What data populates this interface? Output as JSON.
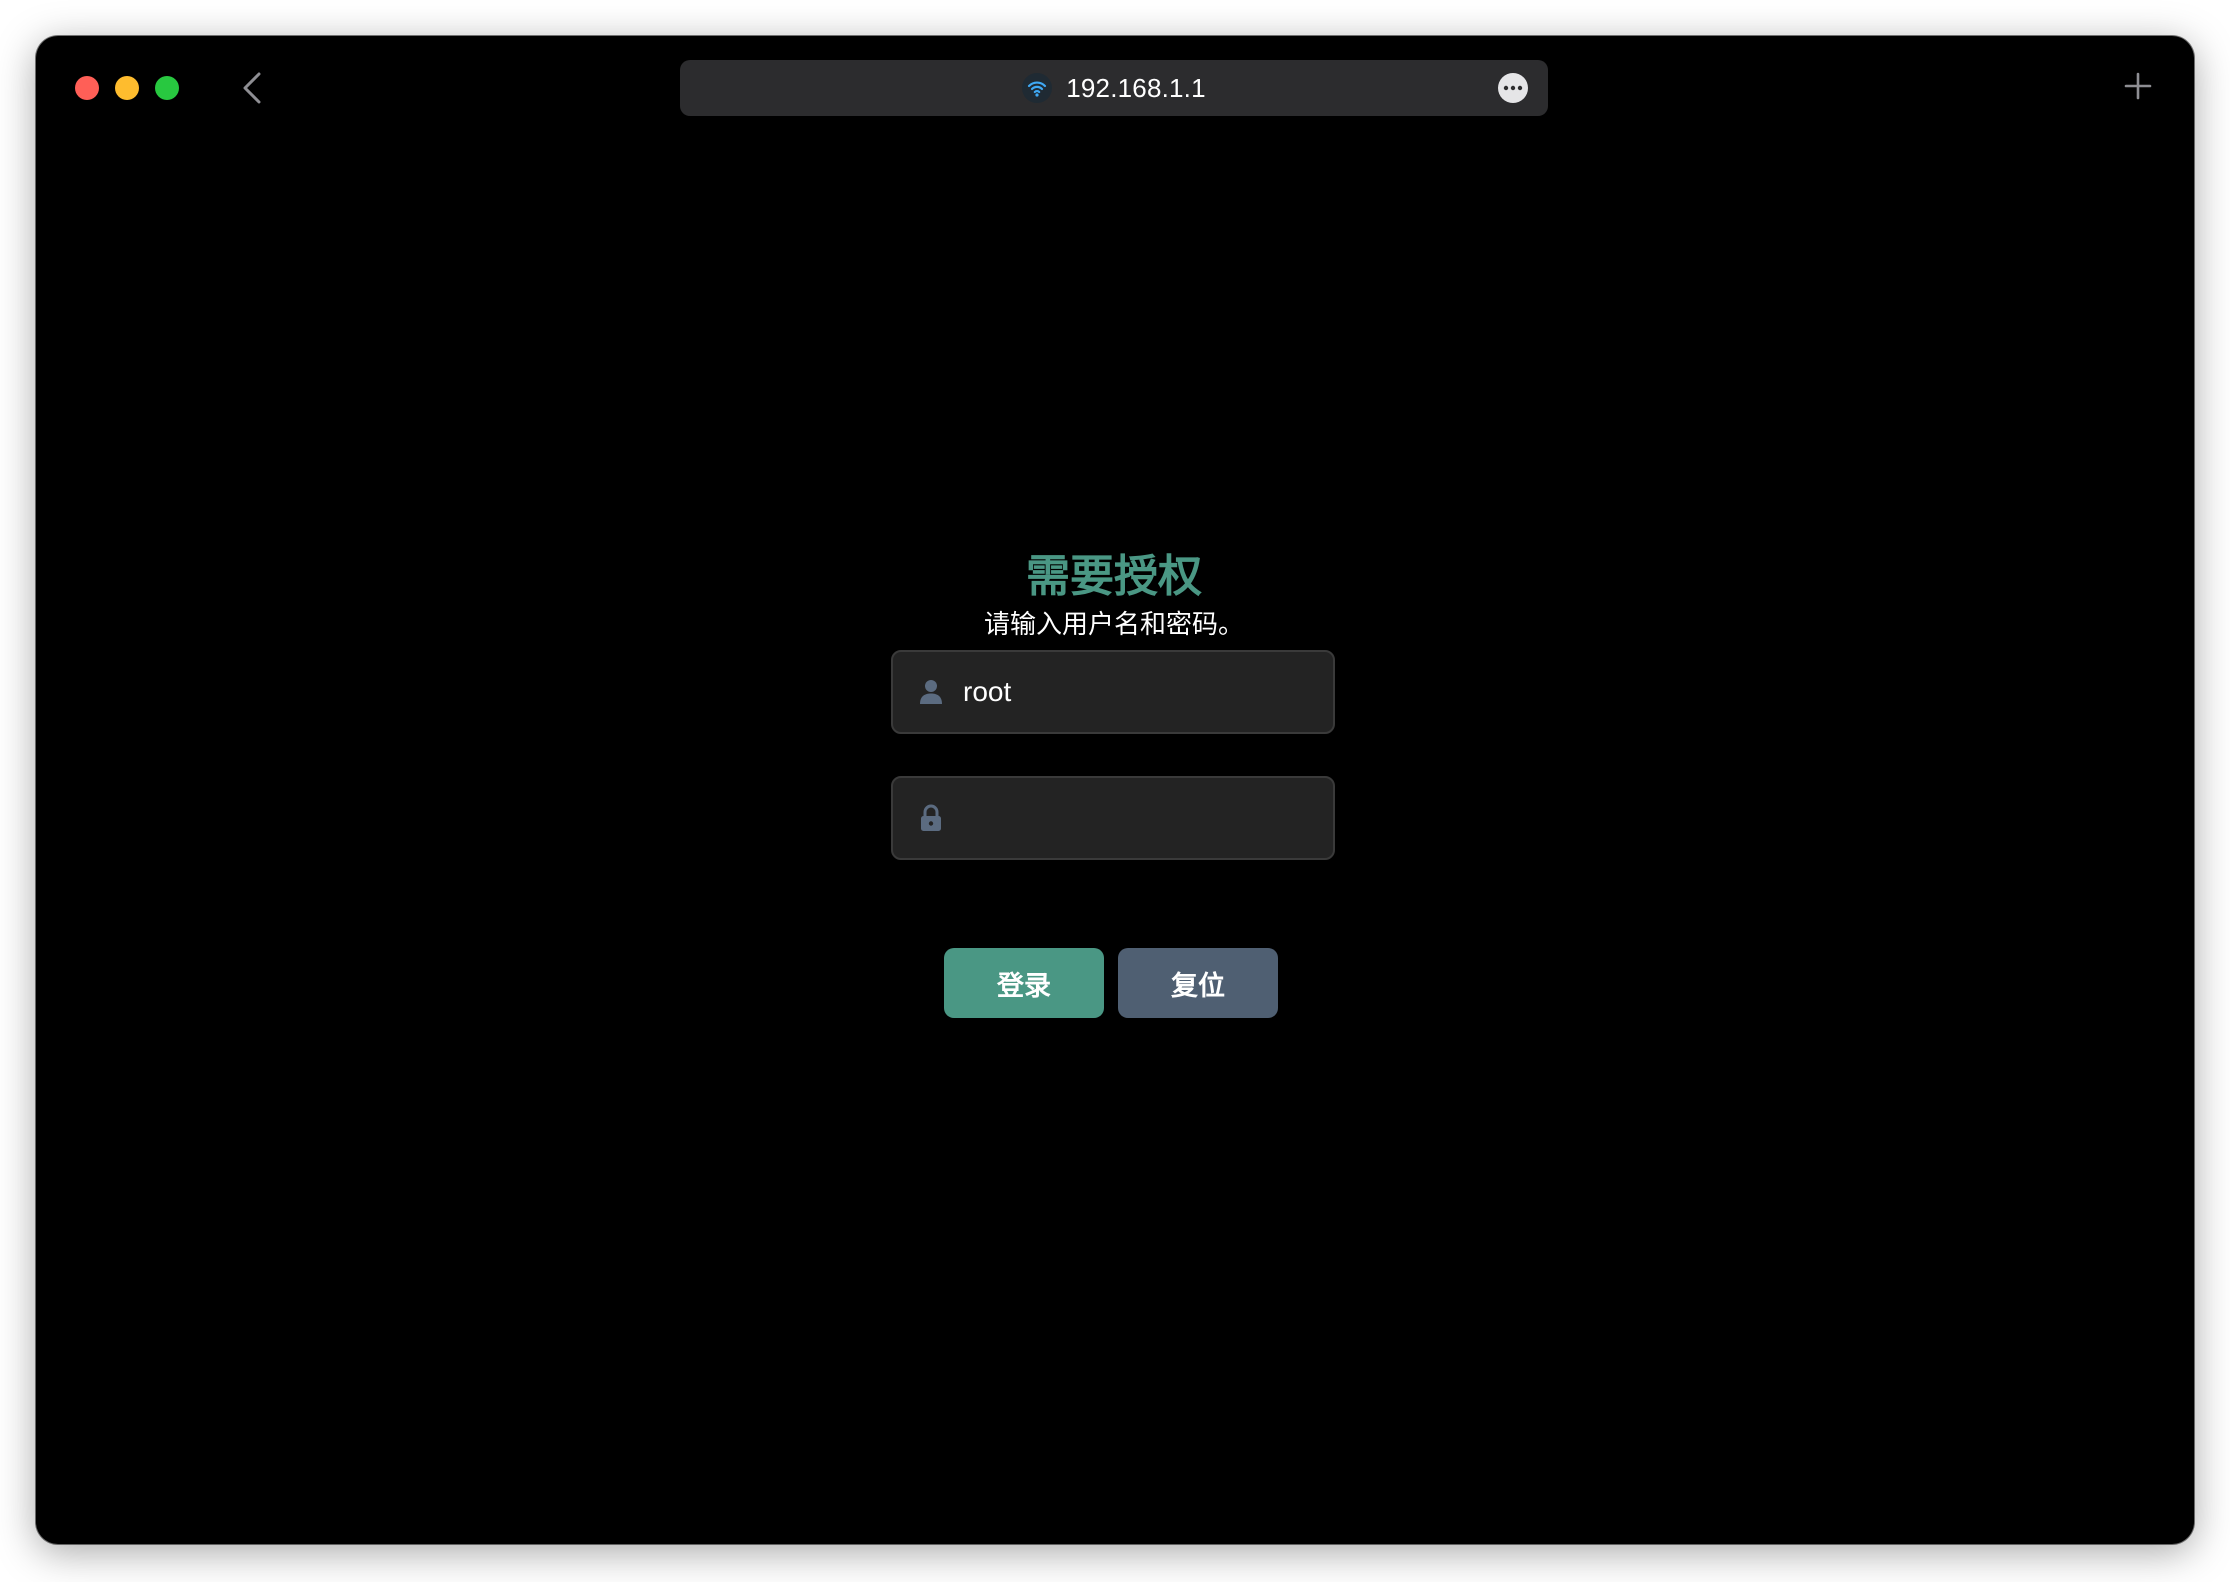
{
  "browser": {
    "url": "192.168.1.1",
    "site_icon": "wifi-icon",
    "more_icon": "ellipsis-icon",
    "back_icon": "chevron-left-icon",
    "new_tab_icon": "plus-icon",
    "traffic_colors": {
      "close": "#ff5f57",
      "minimize": "#febc2e",
      "maximize": "#28c840"
    }
  },
  "login": {
    "title": "需要授权",
    "subtitle": "请输入用户名和密码。",
    "username": {
      "value": "root",
      "icon": "user-icon"
    },
    "password": {
      "value": "",
      "icon": "lock-icon"
    },
    "login_label": "登录",
    "reset_label": "复位",
    "accent_color": "#4a9784",
    "secondary_color": "#4f5f72"
  }
}
